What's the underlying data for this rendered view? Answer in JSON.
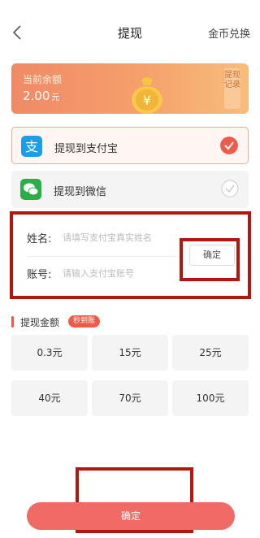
{
  "header": {
    "title": "提现",
    "right_link": "金币兑换"
  },
  "balance": {
    "label": "当前余额",
    "amount": "2.00",
    "unit": "元",
    "record_tab": "提现记录"
  },
  "payment_methods": [
    {
      "label": "提现到支付宝",
      "icon": "alipay-icon",
      "selected": true
    },
    {
      "label": "提现到微信",
      "icon": "wechat-icon",
      "selected": false
    }
  ],
  "form": {
    "name_label": "姓名:",
    "name_placeholder": "请填写支付宝真实姓名",
    "account_label": "账号:",
    "account_placeholder": "请输入支付宝账号",
    "confirm_label": "确定"
  },
  "amount_section": {
    "title": "提现金额",
    "badge": "秒到账",
    "options": [
      "0.3元",
      "15元",
      "25元",
      "40元",
      "70元",
      "100元"
    ]
  },
  "footer": {
    "confirm_label": "确定"
  },
  "colors": {
    "accent": "#f05a4a",
    "confirm_button": "#f06a66",
    "highlight_box": "#b3150f",
    "alipay": "#1a9ee8",
    "wechat": "#2aae4a"
  }
}
